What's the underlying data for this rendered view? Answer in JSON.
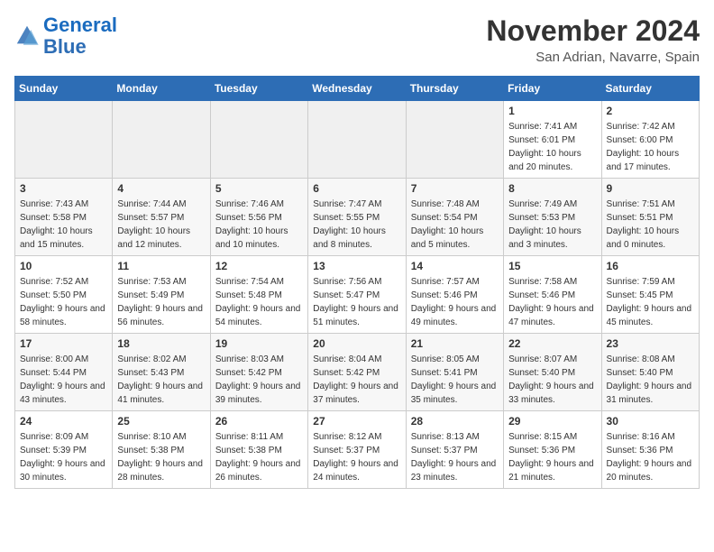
{
  "logo": {
    "line1": "General",
    "line2": "Blue"
  },
  "title": "November 2024",
  "location": "San Adrian, Navarre, Spain",
  "days_of_week": [
    "Sunday",
    "Monday",
    "Tuesday",
    "Wednesday",
    "Thursday",
    "Friday",
    "Saturday"
  ],
  "weeks": [
    [
      {
        "day": "",
        "info": ""
      },
      {
        "day": "",
        "info": ""
      },
      {
        "day": "",
        "info": ""
      },
      {
        "day": "",
        "info": ""
      },
      {
        "day": "",
        "info": ""
      },
      {
        "day": "1",
        "info": "Sunrise: 7:41 AM\nSunset: 6:01 PM\nDaylight: 10 hours and 20 minutes."
      },
      {
        "day": "2",
        "info": "Sunrise: 7:42 AM\nSunset: 6:00 PM\nDaylight: 10 hours and 17 minutes."
      }
    ],
    [
      {
        "day": "3",
        "info": "Sunrise: 7:43 AM\nSunset: 5:58 PM\nDaylight: 10 hours and 15 minutes."
      },
      {
        "day": "4",
        "info": "Sunrise: 7:44 AM\nSunset: 5:57 PM\nDaylight: 10 hours and 12 minutes."
      },
      {
        "day": "5",
        "info": "Sunrise: 7:46 AM\nSunset: 5:56 PM\nDaylight: 10 hours and 10 minutes."
      },
      {
        "day": "6",
        "info": "Sunrise: 7:47 AM\nSunset: 5:55 PM\nDaylight: 10 hours and 8 minutes."
      },
      {
        "day": "7",
        "info": "Sunrise: 7:48 AM\nSunset: 5:54 PM\nDaylight: 10 hours and 5 minutes."
      },
      {
        "day": "8",
        "info": "Sunrise: 7:49 AM\nSunset: 5:53 PM\nDaylight: 10 hours and 3 minutes."
      },
      {
        "day": "9",
        "info": "Sunrise: 7:51 AM\nSunset: 5:51 PM\nDaylight: 10 hours and 0 minutes."
      }
    ],
    [
      {
        "day": "10",
        "info": "Sunrise: 7:52 AM\nSunset: 5:50 PM\nDaylight: 9 hours and 58 minutes."
      },
      {
        "day": "11",
        "info": "Sunrise: 7:53 AM\nSunset: 5:49 PM\nDaylight: 9 hours and 56 minutes."
      },
      {
        "day": "12",
        "info": "Sunrise: 7:54 AM\nSunset: 5:48 PM\nDaylight: 9 hours and 54 minutes."
      },
      {
        "day": "13",
        "info": "Sunrise: 7:56 AM\nSunset: 5:47 PM\nDaylight: 9 hours and 51 minutes."
      },
      {
        "day": "14",
        "info": "Sunrise: 7:57 AM\nSunset: 5:46 PM\nDaylight: 9 hours and 49 minutes."
      },
      {
        "day": "15",
        "info": "Sunrise: 7:58 AM\nSunset: 5:46 PM\nDaylight: 9 hours and 47 minutes."
      },
      {
        "day": "16",
        "info": "Sunrise: 7:59 AM\nSunset: 5:45 PM\nDaylight: 9 hours and 45 minutes."
      }
    ],
    [
      {
        "day": "17",
        "info": "Sunrise: 8:00 AM\nSunset: 5:44 PM\nDaylight: 9 hours and 43 minutes."
      },
      {
        "day": "18",
        "info": "Sunrise: 8:02 AM\nSunset: 5:43 PM\nDaylight: 9 hours and 41 minutes."
      },
      {
        "day": "19",
        "info": "Sunrise: 8:03 AM\nSunset: 5:42 PM\nDaylight: 9 hours and 39 minutes."
      },
      {
        "day": "20",
        "info": "Sunrise: 8:04 AM\nSunset: 5:42 PM\nDaylight: 9 hours and 37 minutes."
      },
      {
        "day": "21",
        "info": "Sunrise: 8:05 AM\nSunset: 5:41 PM\nDaylight: 9 hours and 35 minutes."
      },
      {
        "day": "22",
        "info": "Sunrise: 8:07 AM\nSunset: 5:40 PM\nDaylight: 9 hours and 33 minutes."
      },
      {
        "day": "23",
        "info": "Sunrise: 8:08 AM\nSunset: 5:40 PM\nDaylight: 9 hours and 31 minutes."
      }
    ],
    [
      {
        "day": "24",
        "info": "Sunrise: 8:09 AM\nSunset: 5:39 PM\nDaylight: 9 hours and 30 minutes."
      },
      {
        "day": "25",
        "info": "Sunrise: 8:10 AM\nSunset: 5:38 PM\nDaylight: 9 hours and 28 minutes."
      },
      {
        "day": "26",
        "info": "Sunrise: 8:11 AM\nSunset: 5:38 PM\nDaylight: 9 hours and 26 minutes."
      },
      {
        "day": "27",
        "info": "Sunrise: 8:12 AM\nSunset: 5:37 PM\nDaylight: 9 hours and 24 minutes."
      },
      {
        "day": "28",
        "info": "Sunrise: 8:13 AM\nSunset: 5:37 PM\nDaylight: 9 hours and 23 minutes."
      },
      {
        "day": "29",
        "info": "Sunrise: 8:15 AM\nSunset: 5:36 PM\nDaylight: 9 hours and 21 minutes."
      },
      {
        "day": "30",
        "info": "Sunrise: 8:16 AM\nSunset: 5:36 PM\nDaylight: 9 hours and 20 minutes."
      }
    ]
  ]
}
